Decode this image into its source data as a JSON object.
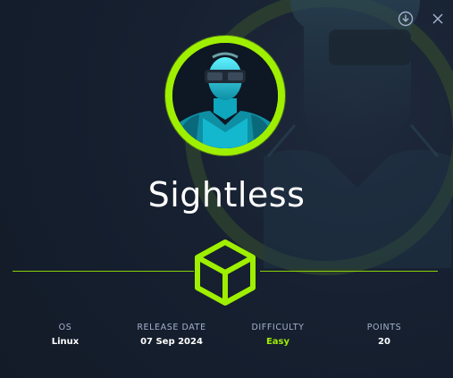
{
  "machine": {
    "name": "Sightless",
    "avatar_alt": "cyan-humanoid-with-visor-avatar"
  },
  "toolbar": {
    "download_icon": "download-icon",
    "close_icon": "close-icon"
  },
  "emblem_icon": "cube-icon",
  "stats": [
    {
      "label": "OS",
      "value": "Linux"
    },
    {
      "label": "RELEASE DATE",
      "value": "07 Sep 2024"
    },
    {
      "label": "DIFFICULTY",
      "value": "Easy"
    },
    {
      "label": "POINTS",
      "value": "20"
    }
  ],
  "colors": {
    "background": "#141d2b",
    "accent": "#9fef00",
    "label": "#a4b1cd",
    "text": "#ffffff"
  }
}
